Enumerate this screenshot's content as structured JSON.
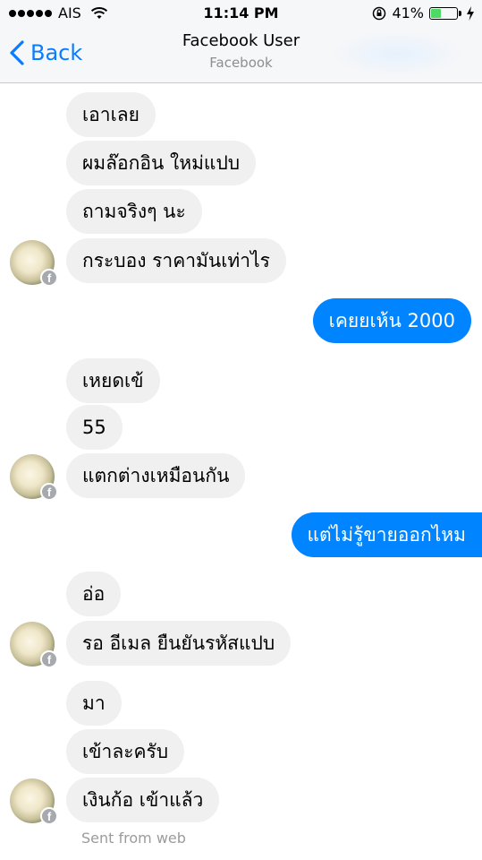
{
  "status": {
    "carrier": "AIS",
    "time": "11:14 PM",
    "battery_text": "41%",
    "battery_level": 0.41,
    "signal_bars": 5,
    "icons": [
      "signal-dots-icon",
      "wifi-icon",
      "rotation-lock-icon",
      "battery-icon",
      "charging-bolt-icon"
    ]
  },
  "nav": {
    "back_label": "Back",
    "title": "Facebook User",
    "subtitle": "Facebook"
  },
  "colors": {
    "accent": "#0a7cff",
    "outgoing_bubble": "#0084ff",
    "incoming_bubble": "#f1f0f0",
    "battery_fill": "#4cd964"
  },
  "messages": [
    {
      "from": "them",
      "text": "เอาเลย"
    },
    {
      "from": "them",
      "text": "ผมล๊อกอิน ใหม่แปบ"
    },
    {
      "from": "them",
      "text": "ถามจริงๆ นะ"
    },
    {
      "from": "them",
      "text": "กระบอง ราคามันเท่าไร"
    },
    {
      "from": "me",
      "text": "เคยยเห้น 2000"
    },
    {
      "from": "them",
      "text": "เหยดเข้"
    },
    {
      "from": "them",
      "text": "55"
    },
    {
      "from": "them",
      "text": "แตกต่างเหมือนกัน"
    },
    {
      "from": "me",
      "text": "แต่ไม่รู้ขายออกไหม"
    },
    {
      "from": "them",
      "text": "อ่อ"
    },
    {
      "from": "them",
      "text": "รอ อีเมล ยืนยันรหัสแปบ"
    },
    {
      "from": "them",
      "text": "มา"
    },
    {
      "from": "them",
      "text": "เข้าละครับ"
    },
    {
      "from": "them",
      "text": "เงินก้อ เข้าแล้ว"
    }
  ],
  "footer": {
    "sent_from": "Sent from web"
  }
}
